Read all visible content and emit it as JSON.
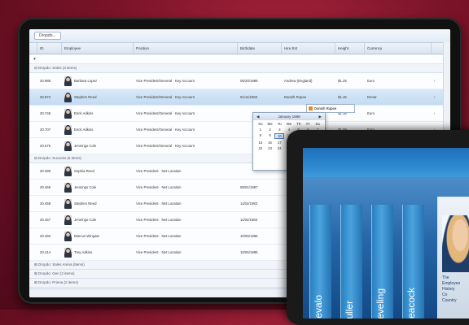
{
  "grid": {
    "group_panel_tag": "Dropdo...",
    "columns": [
      "ID",
      "Employee",
      "Position",
      "Birthdate",
      "Hire Est",
      "Height",
      "Currency",
      ""
    ],
    "filter_placeholder": "",
    "groups": [
      {
        "label": "Dropdo: Sales (3 items)",
        "rows": [
          {
            "id": "20.985",
            "name": "Barbara Lopez",
            "position": "Vice President/General · Key Account",
            "birth": "05/20/1989",
            "hire": "Andrew (England)",
            "height": "$1.25",
            "currency": "Euro",
            "selected": false
          },
          {
            "id": "20.872",
            "name": "Stephen Reed",
            "position": "Vice President/General · Key Account",
            "birth": "01/11/1983",
            "hire": "Danish Rupee",
            "height": "$1.45",
            "currency": "Denar",
            "selected": true
          },
          {
            "id": "20.745",
            "name": "Erick Adkins",
            "position": "Vice President/General · Key Account",
            "birth": "",
            "hire": "",
            "height": "$1.16",
            "currency": "Euro",
            "selected": false
          },
          {
            "id": "20.707",
            "name": "Erick Adkins",
            "position": "Vice President/General · Key Account",
            "birth": "",
            "hire": "",
            "height": "$1.08",
            "currency": "Euro",
            "selected": false
          },
          {
            "id": "20.676",
            "name": "Jennings Cole",
            "position": "Vice President/General · Key Account",
            "birth": "",
            "hire": "",
            "height": "",
            "currency": "",
            "selected": false
          }
        ]
      },
      {
        "label": "Dropdo: Success (6 items)",
        "rows": [
          {
            "id": "20.480",
            "name": "Sophia Reed",
            "position": "Vice President · Net Location",
            "birth": "",
            "hire": "",
            "height": "",
            "currency": "",
            "selected": false
          },
          {
            "id": "20.465",
            "name": "Jennings Cole",
            "position": "Vice President · Net Location",
            "birth": "08/01/1987",
            "hire": "",
            "height": "",
            "currency": "",
            "selected": false
          },
          {
            "id": "20.458",
            "name": "Stephen Reed",
            "position": "Vice President · Net Location",
            "birth": "11/02/1983",
            "hire": "",
            "height": "",
            "currency": "",
            "selected": false
          },
          {
            "id": "20.457",
            "name": "Jennings Cole",
            "position": "Vice President · Net Location",
            "birth": "11/02/1983",
            "hire": "",
            "height": "",
            "currency": "",
            "selected": false
          },
          {
            "id": "20.450",
            "name": "Marcus Wingate",
            "position": "Vice President · Net Location",
            "birth": "10/05/1985",
            "hire": "",
            "height": "",
            "currency": "",
            "selected": false
          },
          {
            "id": "20.414",
            "name": "Trey Adkins",
            "position": "Vice President · Net Location",
            "birth": "10/05/1985",
            "hire": "",
            "height": "",
            "currency": "",
            "selected": false
          }
        ]
      }
    ],
    "footer_groups": [
      "Dropdo: Sales Arena (Items)",
      "Dropdo: Gen (2 items)",
      "Dropdo: Priena (2 items)",
      "Dropdo: Gen (3 items)"
    ],
    "dropdown_tag": "Danish Rupee",
    "calendar": {
      "title": "January 1989",
      "dow": [
        "Su",
        "Mo",
        "Tu",
        "We",
        "Th",
        "Fr",
        "Sa"
      ],
      "days": [
        "1",
        "2",
        "3",
        "4",
        "5",
        "6",
        "7",
        "8",
        "9",
        "10",
        "11",
        "12",
        "13",
        "14",
        "15",
        "16",
        "17",
        "18",
        "19",
        "20",
        "21",
        "22",
        "23",
        "24",
        "25",
        "26",
        "27",
        "28"
      ],
      "today": "10"
    }
  },
  "tablet": {
    "pillars": [
      "Devalo",
      "Fuller",
      "Leveling",
      "Peacock"
    ],
    "card_lines": [
      "The",
      "Employee",
      "History",
      "Co",
      "Country"
    ]
  },
  "colors": {
    "background": "#7a1328",
    "accent": "#2c86cf",
    "selection": "#c3dbf3"
  }
}
